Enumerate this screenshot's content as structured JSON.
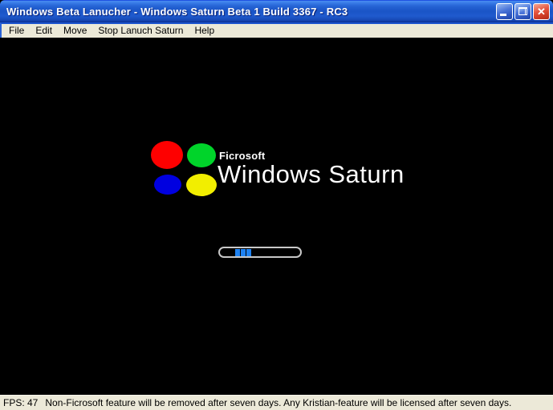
{
  "window": {
    "title": "Windows Beta Lanucher - Windows Saturn Beta 1 Build 3367 - RC3",
    "controls": {
      "minimize": "minimize",
      "restore": "restore",
      "close": "close",
      "close_glyph": "✕"
    },
    "colors": {
      "titlebar_blue": "#1a54c6",
      "chrome_beige": "#ece9d8",
      "close_red": "#e4543e"
    }
  },
  "menu": {
    "items": [
      {
        "label": "File"
      },
      {
        "label": "Edit"
      },
      {
        "label": "Move"
      },
      {
        "label": "Stop Lanuch Saturn"
      },
      {
        "label": "Help"
      }
    ]
  },
  "splash": {
    "brand": "Ficrosoft",
    "product": "Windows Saturn",
    "orbs": [
      {
        "name": "red",
        "color": "#fe0000"
      },
      {
        "name": "green",
        "color": "#00d42a"
      },
      {
        "name": "blue",
        "color": "#0000e0"
      },
      {
        "name": "yellow",
        "color": "#f2ee00"
      }
    ],
    "progress": {
      "segment_count": 3,
      "segment_color": "#1e82f2"
    }
  },
  "status": {
    "fps": "FPS: 47",
    "message": "Non-Ficrosoft feature will be removed after seven days. Any Kristian-feature will be licensed after seven days."
  }
}
